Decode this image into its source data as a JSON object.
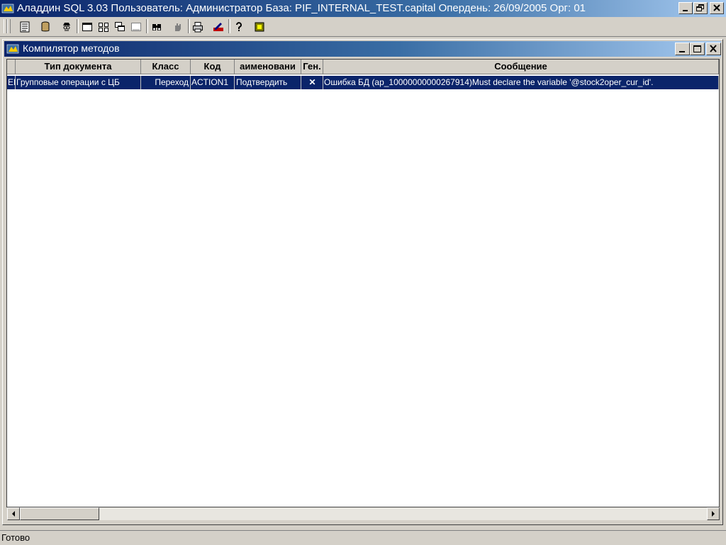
{
  "app": {
    "title": "Аладдин SQL 3.03 Пользователь: Администратор База: PIF_INTERNAL_TEST.capital Опердень: 26/09/2005 Орг: 01"
  },
  "toolbar": {
    "buttons": [
      "document-icon",
      "database-icon",
      "spy-icon",
      "window-icon",
      "tile-icon",
      "cascade-icon",
      "window-disabled-icon",
      "binoculars-icon",
      "hand-icon",
      "print-icon",
      "pen-icon",
      "help-icon",
      "book-icon"
    ]
  },
  "child_window": {
    "title": "Компилятор методов"
  },
  "grid": {
    "columns": [
      "",
      "Тип документа",
      "Класс",
      "Код",
      "аименовани",
      "Ген.",
      "Сообщение"
    ],
    "rows": [
      {
        "marker": "ЕМ",
        "doc_type": "Групповые операции с ЦБ",
        "class": "Переход",
        "code": "ACTION1",
        "name": "Подтвердить",
        "gen": "✕",
        "message": "Ошибка БД (ap_10000000000267914)Must declare the variable '@stock2oper_cur_id'."
      }
    ]
  },
  "status": {
    "text": "Готово"
  },
  "colors": {
    "selection": "#0a246a",
    "title_gradient_start": "#0a246a",
    "face": "#d4d0c8"
  }
}
